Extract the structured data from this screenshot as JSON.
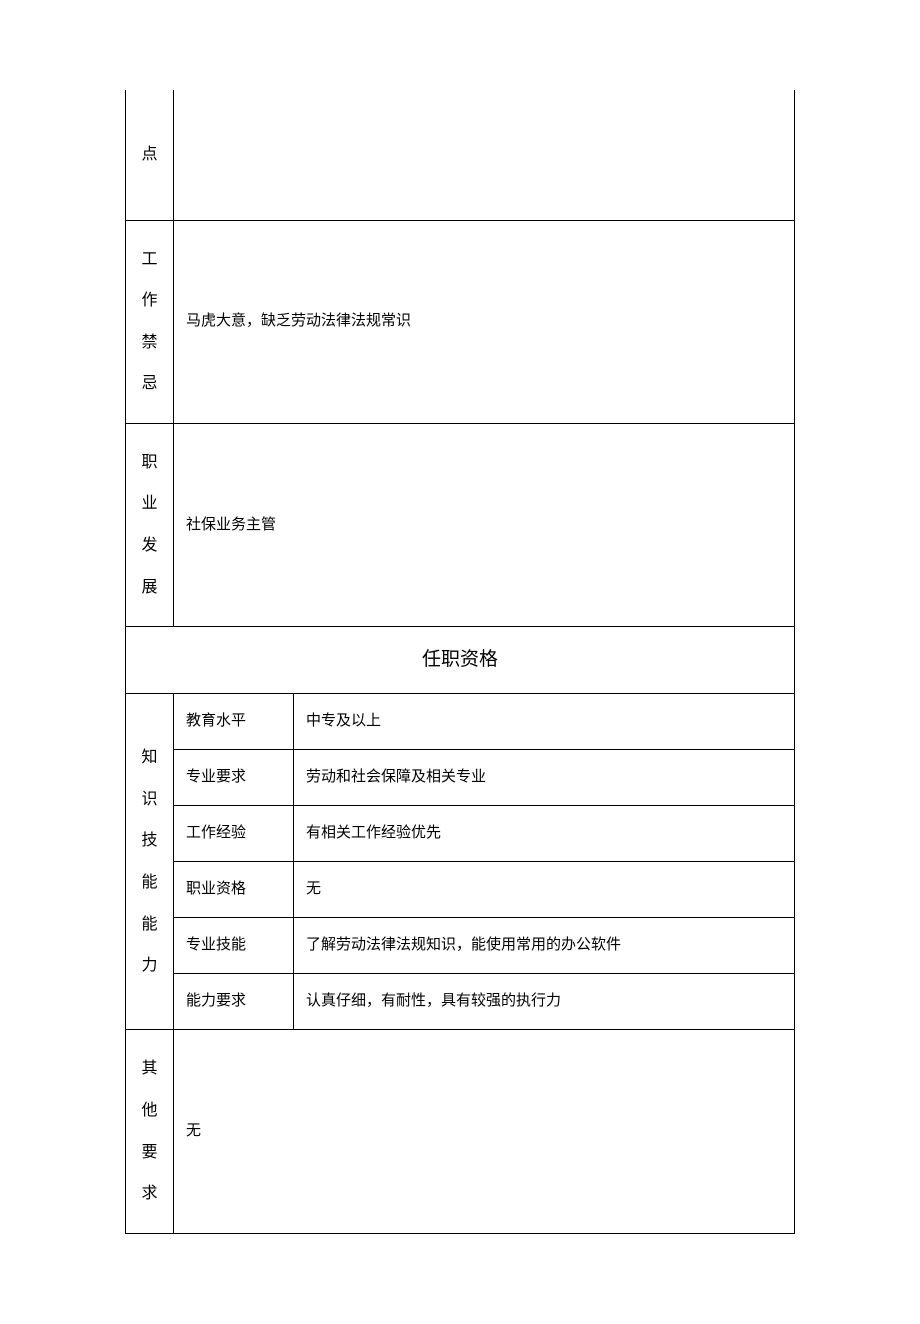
{
  "rows": {
    "dian": {
      "label": "点",
      "value": ""
    },
    "work_taboo": {
      "label": "工作禁忌",
      "value": "马虎大意，缺乏劳动法律法规常识"
    },
    "career_dev": {
      "label": "职业发展",
      "value": "社保业务主管"
    },
    "section": "任职资格",
    "knowledge_skills": {
      "label": "知识技能能力",
      "items": [
        {
          "sub": "教育水平",
          "val": "中专及以上"
        },
        {
          "sub": "专业要求",
          "val": "劳动和社会保障及相关专业"
        },
        {
          "sub": "工作经验",
          "val": "有相关工作经验优先"
        },
        {
          "sub": "职业资格",
          "val": "无"
        },
        {
          "sub": "专业技能",
          "val": "了解劳动法律法规知识，能使用常用的办公软件"
        },
        {
          "sub": "能力要求",
          "val": "认真仔细，有耐性，具有较强的执行力"
        }
      ]
    },
    "other_req": {
      "label": "其他要求",
      "value": "无"
    }
  }
}
